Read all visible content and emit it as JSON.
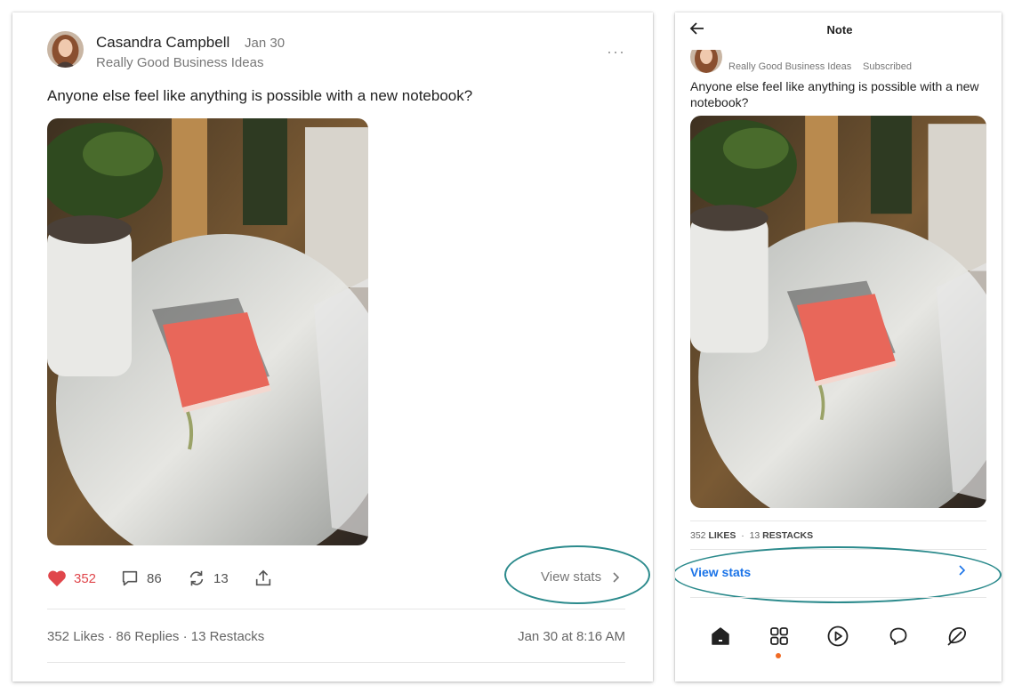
{
  "desktop_note": {
    "author_name": "Casandra Campbell",
    "date": "Jan 30",
    "publication": "Really Good Business Ideas",
    "more_label": "···",
    "text": "Anyone else feel like anything is possible with a new notebook?",
    "image_alt": "Red notebook on white round table in sunlight",
    "likes_count": "352",
    "replies_count": "86",
    "restacks_count": "13",
    "view_stats_label": "View stats",
    "stats_line": "352 Likes · 86 Replies · 13 Restacks",
    "timestamp": "Jan 30 at 8:16 AM",
    "colors": {
      "like": "#e0464b",
      "annotation": "#2b8a8c"
    }
  },
  "mobile_note": {
    "header_title": "Note",
    "publication": "Really Good Business Ideas",
    "subscribed_label": "Subscribed",
    "text": "Anyone else feel like anything is possible with a new notebook?",
    "stats": {
      "likes_num": "352",
      "likes_label": "LIKES",
      "sep": "·",
      "restacks_num": "13",
      "restacks_label": "RESTACKS"
    },
    "view_stats_label": "View stats",
    "tabs": [
      "home-icon",
      "grid-icon",
      "play-icon",
      "chat-icon",
      "compose-icon"
    ],
    "colors": {
      "link": "#1a73e8",
      "notification_dot": "#f06a24"
    }
  }
}
